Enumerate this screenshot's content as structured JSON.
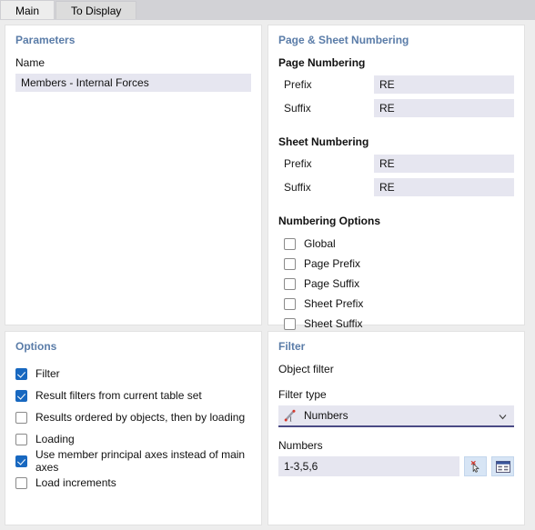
{
  "tabs": [
    {
      "label": "Main",
      "active": true
    },
    {
      "label": "To Display",
      "active": false
    }
  ],
  "parameters": {
    "title": "Parameters",
    "name_label": "Name",
    "name_value": "Members - Internal Forces",
    "name_placeholder": ""
  },
  "numbering": {
    "title": "Page & Sheet Numbering",
    "page_section": "Page Numbering",
    "page_prefix_label": "Prefix",
    "page_prefix_value": "RE",
    "page_suffix_label": "Suffix",
    "page_suffix_value": "RE",
    "sheet_section": "Sheet Numbering",
    "sheet_prefix_label": "Prefix",
    "sheet_prefix_value": "RE",
    "sheet_suffix_label": "Suffix",
    "sheet_suffix_value": "RE",
    "options_section": "Numbering Options",
    "options": [
      {
        "label": "Global",
        "checked": false
      },
      {
        "label": "Page Prefix",
        "checked": false
      },
      {
        "label": "Page Suffix",
        "checked": false
      },
      {
        "label": "Sheet Prefix",
        "checked": false
      },
      {
        "label": "Sheet Suffix",
        "checked": false
      }
    ]
  },
  "options": {
    "title": "Options",
    "items": [
      {
        "label": "Filter",
        "checked": true
      },
      {
        "label": "Result filters from current table set",
        "checked": true
      },
      {
        "label": "Results ordered by objects, then by loading",
        "checked": false
      },
      {
        "label": "Loading",
        "checked": false
      },
      {
        "label": "Use member principal axes instead of main axes",
        "checked": true
      },
      {
        "label": "Load increments",
        "checked": false
      }
    ]
  },
  "filter": {
    "title": "Filter",
    "object_filter_label": "Object filter",
    "filter_type_label": "Filter type",
    "filter_type_value": "Numbers",
    "filter_type_icon": "numbers-pick-icon",
    "numbers_label": "Numbers",
    "numbers_value": "1-3,5,6",
    "pick_button_icon": "cursor-deselect-icon",
    "table_button_icon": "table-dialog-icon"
  },
  "colors": {
    "accent": "#1868c0",
    "panel_title": "#5a7ca8",
    "field_bg": "#e6e6f0",
    "dropdown_underline": "#4a4a85",
    "window_bg": "#ededed",
    "tabstrip_bg": "#d2d2d6"
  }
}
